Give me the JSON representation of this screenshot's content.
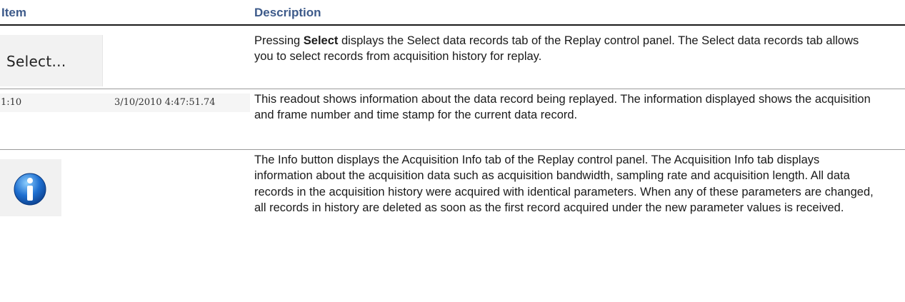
{
  "table": {
    "headers": {
      "item": "Item",
      "description": "Description"
    },
    "rows": [
      {
        "image": {
          "icon": "select-button-icon",
          "button_label": "Select..."
        },
        "desc_before": "Pressing ",
        "desc_bold": "Select",
        "desc_after": " displays the Select data records tab of the Replay control panel.  The Select data records tab allows you to select records from acquisition history for replay."
      },
      {
        "image": {
          "icon": "readout-icon",
          "acq_frame": "1:10",
          "timestamp": "3/10/2010 4:47:51.74"
        },
        "description": "This readout shows information about the data record being replayed.  The information displayed shows the acquisition and frame number and time stamp for the current data record."
      },
      {
        "image": {
          "icon": "info-icon"
        },
        "description": "The Info button displays the Acquisition Info tab of the Replay control panel.  The Acquisition Info tab displays information about the acquisition data such as acquisition bandwidth, sampling rate and acquisition length. All data records in the acquisition history were acquired with identical parameters.  When any of these parameters are changed, all records in history are deleted as soon as the first record acquired under the new parameter values is received."
      }
    ]
  },
  "colors": {
    "header_text": "#3d5a8a",
    "info_icon_blue": "#1e6fd0"
  }
}
